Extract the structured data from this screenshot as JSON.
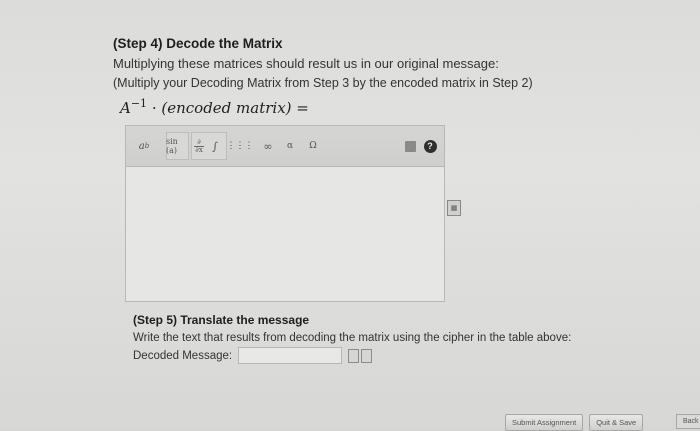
{
  "step4": {
    "title": "(Step 4) Decode the Matrix",
    "description": "Multiplying these matrices should result us in our original message:",
    "instruction": "(Multiply your Decoding Matrix from Step 3 by the encoded matrix in Step 2)",
    "formula_base": "A",
    "formula_exponent": "−1",
    "formula_rest": "· (encoded matrix) ="
  },
  "toolbar": {
    "power_label": "a",
    "power_sup": "b",
    "sin_label": "sin (a)",
    "deriv_num": "∂",
    "deriv_den": "∂x",
    "integral_label": "∫",
    "matrix_label": "⋮⋮⋮",
    "infinity_label": "∞",
    "alpha_label": "α",
    "omega_label": "Ω",
    "help_label": "?"
  },
  "step5": {
    "title": "(Step 5) Translate the message",
    "description": "Write the text that results from decoding the matrix using the cipher in the table above:",
    "decoded_label": "Decoded Message:",
    "decoded_value": ""
  },
  "footer": {
    "submit_label": "Submit Assignment",
    "quit_label": "Quit & Save",
    "back_label": "Back"
  },
  "icons": {
    "trash": "trash-icon",
    "help": "help-icon",
    "keypad": "keypad-icon"
  }
}
